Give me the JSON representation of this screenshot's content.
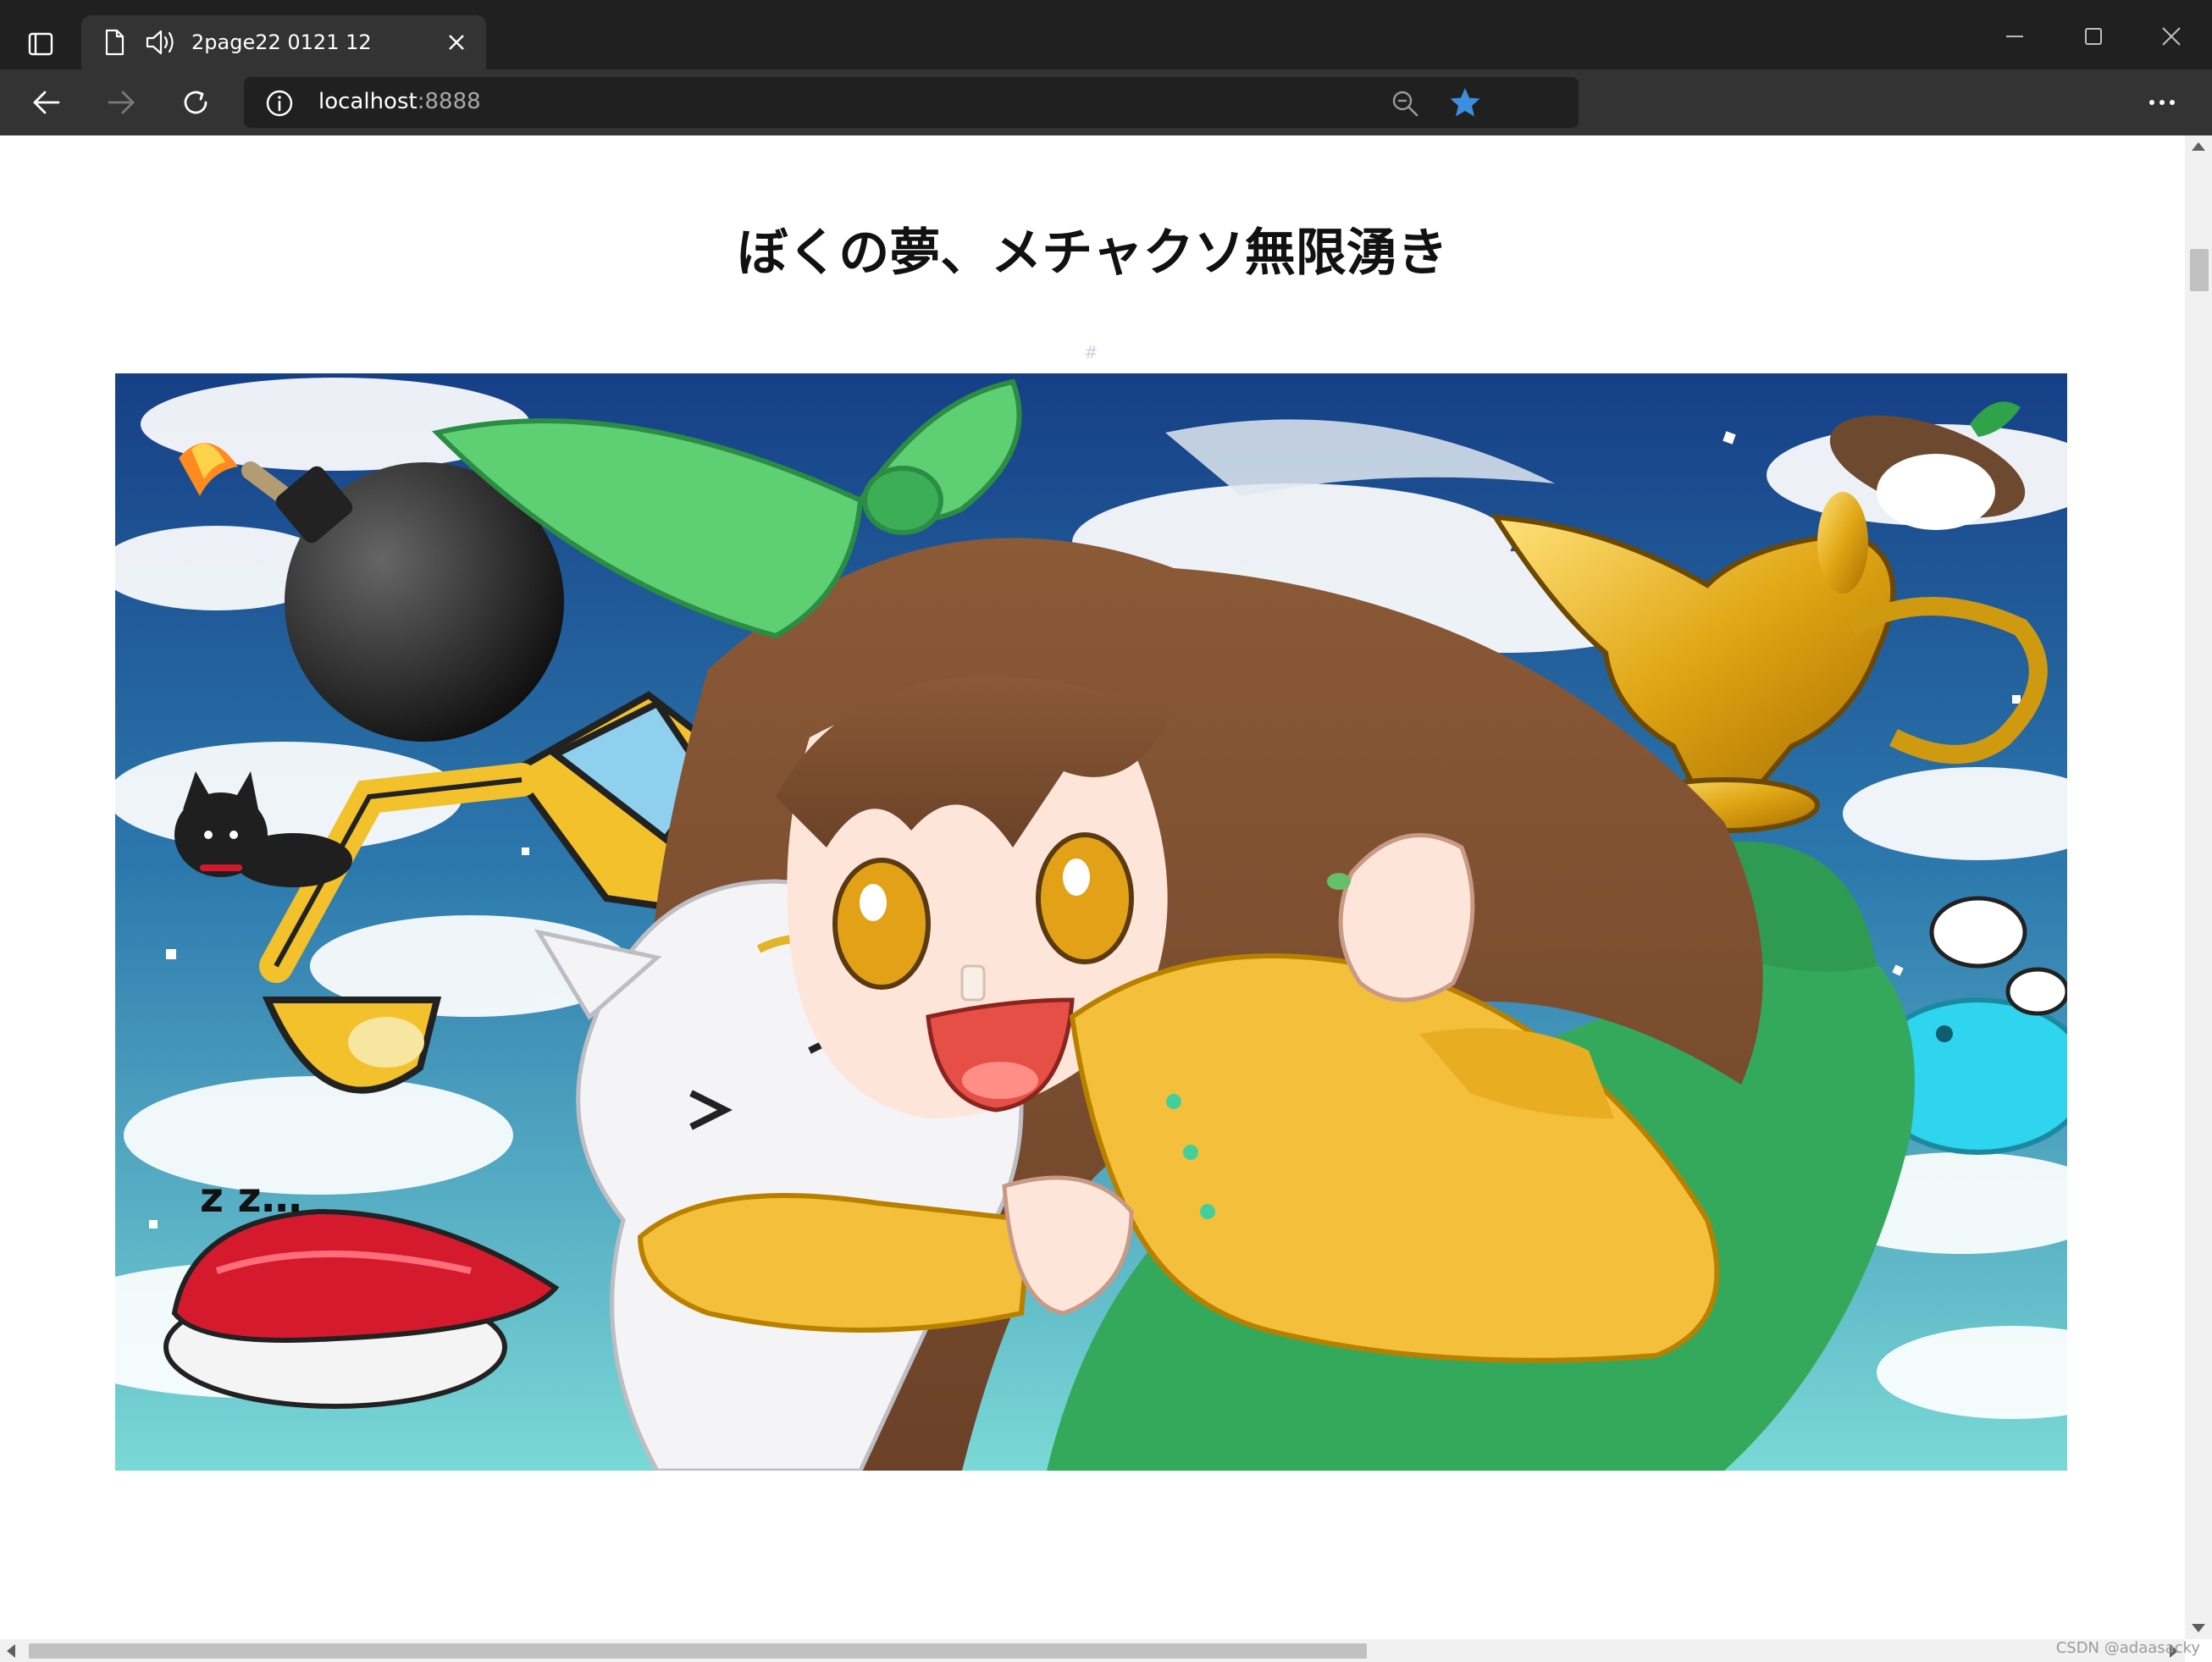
{
  "browser": {
    "tab": {
      "title": "2page22 0121 12"
    },
    "address": {
      "host": "localhost",
      "port": ":8888"
    }
  },
  "page": {
    "title": "ぼくの夢、メチャクソ無限湧き",
    "anchor": "#",
    "illustration": {
      "sound_effect": "z z…"
    }
  },
  "watermark": "CSDN @adaasacky",
  "icons": {
    "tab_actions": "tab-actions-icon",
    "tab_page": "page-icon",
    "tab_audio": "speaker-icon",
    "tab_close": "close-icon",
    "minimize": "minimize-icon",
    "maximize": "maximize-icon",
    "window_close": "window-close-icon",
    "back": "back-arrow-icon",
    "forward": "forward-arrow-icon",
    "refresh": "refresh-icon",
    "site_info": "info-icon",
    "zoom": "zoom-out-icon",
    "favorite": "star-icon",
    "menu": "more-horizontal-icon"
  },
  "colors": {
    "frame": "#202020",
    "toolbar": "#333333",
    "star": "#3d8ee0",
    "page_background": "#ffffff"
  }
}
